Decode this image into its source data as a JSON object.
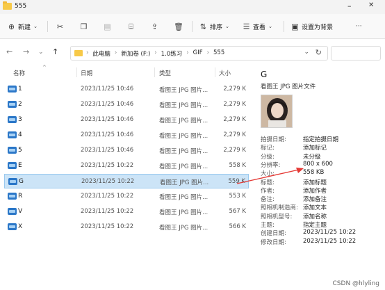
{
  "window": {
    "title": "555"
  },
  "toolbar": {
    "new_label": "新建",
    "sort_label": "排序",
    "view_label": "查看",
    "set_background_label": "设置为背景",
    "more_label": "···"
  },
  "address": {
    "crumbs": [
      "此电脑",
      "新加卷 (F:)",
      "1.0练习",
      "GIF",
      "555"
    ]
  },
  "columns": {
    "name": "名称",
    "date": "日期",
    "type": "类型",
    "size": "大小"
  },
  "files": [
    {
      "name": "1",
      "date": "2023/11/25 10:46",
      "type": "看图王 JPG 图片...",
      "size": "2,279 K"
    },
    {
      "name": "2",
      "date": "2023/11/25 10:46",
      "type": "看图王 JPG 图片...",
      "size": "2,279 K"
    },
    {
      "name": "3",
      "date": "2023/11/25 10:46",
      "type": "看图王 JPG 图片...",
      "size": "2,279 K"
    },
    {
      "name": "4",
      "date": "2023/11/25 10:46",
      "type": "看图王 JPG 图片...",
      "size": "2,279 K"
    },
    {
      "name": "5",
      "date": "2023/11/25 10:46",
      "type": "看图王 JPG 图片...",
      "size": "2,279 K"
    },
    {
      "name": "E",
      "date": "2023/11/25 10:22",
      "type": "看图王 JPG 图片...",
      "size": "558 K"
    },
    {
      "name": "G",
      "date": "2023/11/25 10:22",
      "type": "看图王 JPG 图片...",
      "size": "559 K"
    },
    {
      "name": "R",
      "date": "2023/11/25 10:22",
      "type": "看图王 JPG 图片...",
      "size": "553 K"
    },
    {
      "name": "V",
      "date": "2023/11/25 10:22",
      "type": "看图王 JPG 图片...",
      "size": "567 K"
    },
    {
      "name": "X",
      "date": "2023/11/25 10:22",
      "type": "看图王 JPG 图片...",
      "size": "566 K"
    }
  ],
  "selected_file": "G",
  "details": {
    "name": "G",
    "type": "看图王 JPG 图片文件",
    "props": [
      {
        "k": "拍摄日期:",
        "v": "指定拍摄日期"
      },
      {
        "k": "标记:",
        "v": "添加标记"
      },
      {
        "k": "分级:",
        "v": "未分级"
      },
      {
        "k": "分辨率:",
        "v": "800 x 600"
      },
      {
        "k": "大小:",
        "v": "558 KB"
      },
      {
        "k": "标题:",
        "v": "添加标题"
      },
      {
        "k": "作者:",
        "v": "添加作者"
      },
      {
        "k": "备注:",
        "v": "添加备注"
      },
      {
        "k": "照相机制造商:",
        "v": "添加文本"
      },
      {
        "k": "照相机型号:",
        "v": "添加名称"
      },
      {
        "k": "主题:",
        "v": "指定主题"
      },
      {
        "k": "创建日期:",
        "v": "2023/11/25 10:22"
      },
      {
        "k": "修改日期:",
        "v": "2023/11/25 10:22"
      }
    ]
  },
  "watermark": "CSDN @hlyling",
  "colors": {
    "selection": "#cce4f7",
    "folder": "#f7c948",
    "annotation_arrow": "#e53935"
  }
}
